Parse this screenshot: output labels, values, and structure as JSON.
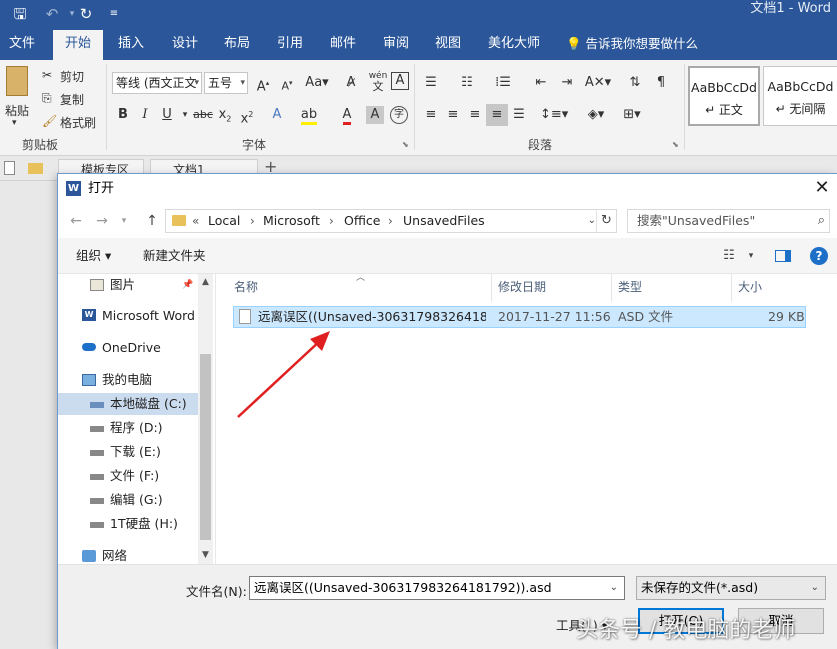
{
  "word": {
    "title": "文档1 - Word",
    "tabs": [
      "文件",
      "开始",
      "插入",
      "设计",
      "布局",
      "引用",
      "邮件",
      "审阅",
      "视图",
      "美化大师"
    ],
    "active_tab": "开始",
    "tell_me": "告诉我你想要做什么",
    "ribbon": {
      "clipboard": {
        "paste": "粘贴",
        "cut": "剪切",
        "copy": "复制",
        "format_painter": "格式刷",
        "group": "剪贴板"
      },
      "font": {
        "font_name": "等线 (西文正文",
        "font_size": "五号",
        "group": "字体",
        "phonetic": "wén"
      },
      "paragraph": {
        "group": "段落"
      },
      "styles": [
        {
          "sample": "AaBbCcDd",
          "name": "↵ 正文"
        },
        {
          "sample": "AaBbCcDd",
          "name": "↵ 无间隔"
        }
      ]
    },
    "doc_tabs": [
      "模板专区",
      "文档1"
    ]
  },
  "dialog": {
    "title": "打开",
    "breadcrumb": [
      "Local",
      "Microsoft",
      "Office",
      "UnsavedFiles"
    ],
    "search_placeholder": "搜索\"UnsavedFiles\"",
    "organize": "组织 ▾",
    "new_folder": "新建文件夹",
    "nav_items": [
      {
        "label": "图片",
        "icon": "pictures-icon"
      },
      {
        "label": "Microsoft Word",
        "icon": "word-icon"
      },
      {
        "label": "OneDrive",
        "icon": "onedrive-icon"
      },
      {
        "label": "我的电脑",
        "icon": "computer-icon"
      },
      {
        "label": "本地磁盘 (C:)",
        "icon": "drive-c-icon"
      },
      {
        "label": "程序 (D:)",
        "icon": "drive-icon"
      },
      {
        "label": "下载 (E:)",
        "icon": "drive-icon"
      },
      {
        "label": "文件 (F:)",
        "icon": "drive-icon"
      },
      {
        "label": "编辑 (G:)",
        "icon": "drive-icon"
      },
      {
        "label": "1T硬盘 (H:)",
        "icon": "drive-icon"
      },
      {
        "label": "网络",
        "icon": "network-icon"
      }
    ],
    "columns": [
      "名称",
      "修改日期",
      "类型",
      "大小"
    ],
    "files": [
      {
        "name": "远离误区((Unsaved-306317983264181...",
        "modified": "2017-11-27 11:56",
        "type": "ASD 文件",
        "size": "29 KB"
      }
    ],
    "filename_label": "文件名(N):",
    "filename_value": "远离误区((Unsaved-306317983264181792)).asd",
    "filetype_value": "未保存的文件(*.asd)",
    "tools": "工具(L) ▾",
    "open": "打开(O)",
    "cancel": "取消"
  },
  "watermark": "头条号 / 教电脑的老师",
  "colors": {
    "word_blue": "#2b579a",
    "selection": "#cce8ff",
    "arrow": "#e02020"
  }
}
